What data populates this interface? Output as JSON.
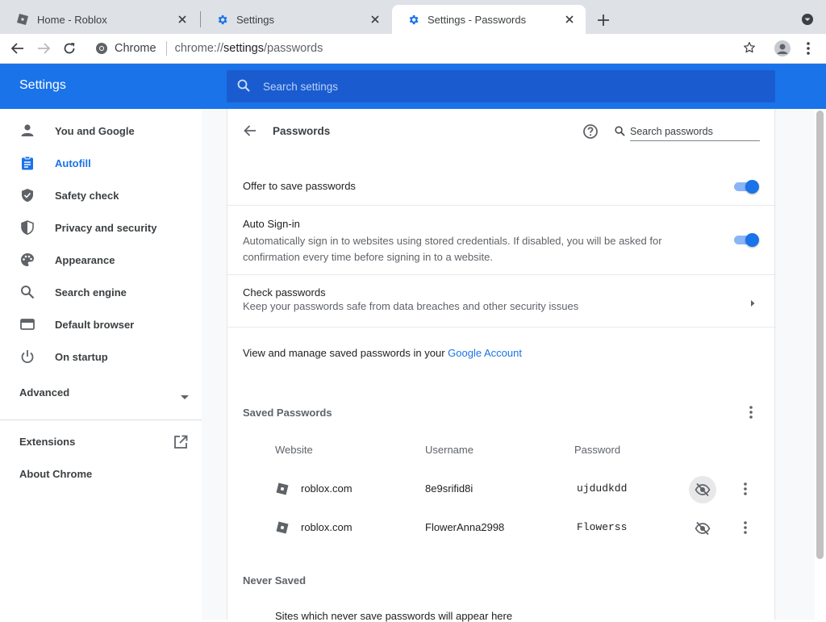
{
  "tabs": [
    {
      "title": "Home - Roblox",
      "icon": "roblox-icon",
      "active": false
    },
    {
      "title": "Settings",
      "icon": "gear-icon",
      "active": false
    },
    {
      "title": "Settings - Passwords",
      "icon": "gear-icon",
      "active": true
    }
  ],
  "toolbar": {
    "site_label": "Chrome",
    "url_scheme": "chrome://",
    "url_host": "settings",
    "url_path": "/passwords"
  },
  "header": {
    "title": "Settings",
    "search_placeholder": "Search settings"
  },
  "sidebar": {
    "items": [
      {
        "label": "You and Google",
        "icon": "person-icon"
      },
      {
        "label": "Autofill",
        "icon": "clipboard-icon",
        "active": true
      },
      {
        "label": "Safety check",
        "icon": "shield-check-icon"
      },
      {
        "label": "Privacy and security",
        "icon": "shield-half-icon"
      },
      {
        "label": "Appearance",
        "icon": "palette-icon"
      },
      {
        "label": "Search engine",
        "icon": "search-icon"
      },
      {
        "label": "Default browser",
        "icon": "browser-icon"
      },
      {
        "label": "On startup",
        "icon": "power-icon"
      }
    ],
    "advanced_label": "Advanced",
    "extensions_label": "Extensions",
    "about_label": "About Chrome"
  },
  "passwords": {
    "title": "Passwords",
    "search_placeholder": "Search passwords",
    "offer_label": "Offer to save passwords",
    "offer_enabled": true,
    "auto_signin_label": "Auto Sign-in",
    "auto_signin_desc": "Automatically sign in to websites using stored credentials. If disabled, you will be asked for confirmation every time before signing in to a website.",
    "auto_signin_enabled": true,
    "check_label": "Check passwords",
    "check_desc": "Keep your passwords safe from data breaches and other security issues",
    "manage_text": "View and manage saved passwords in your ",
    "manage_link": "Google Account",
    "saved_title": "Saved Passwords",
    "columns": {
      "website": "Website",
      "username": "Username",
      "password": "Password"
    },
    "entries": [
      {
        "site": "roblox.com",
        "username": "8e9srifid8i",
        "password": "ujdudkdd"
      },
      {
        "site": "roblox.com",
        "username": "FlowerAnna2998",
        "password": "Flowerss"
      }
    ],
    "never_title": "Never Saved",
    "never_note": "Sites which never save passwords will appear here"
  },
  "colors": {
    "accent": "#1a73e8",
    "header_bg": "#1a73e8",
    "search_bg": "#1a5ccf"
  }
}
